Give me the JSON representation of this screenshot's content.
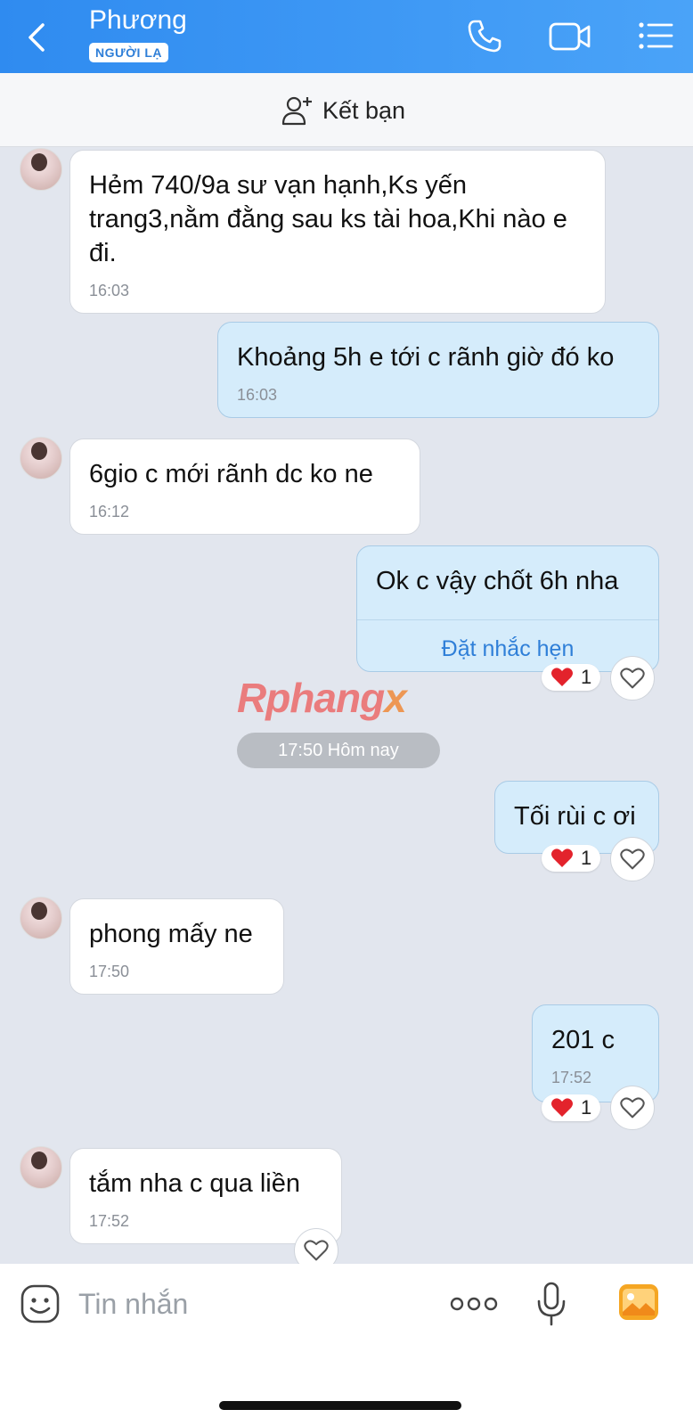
{
  "header": {
    "name": "Phương",
    "badge": "NGƯỜI LẠ",
    "bg_color": "#2f8bf0",
    "icons": [
      "back-chevron-icon",
      "phone-icon",
      "video-camera-icon",
      "menu-list-icon"
    ]
  },
  "add_friend": {
    "label": "Kết bạn",
    "icon": "add-user-icon"
  },
  "messages": [
    {
      "from": "them",
      "text": "Hẻm 740/9a sư vạn hạnh,Ks yến trang3,nằm đằng sau ks tài hoa,Khi nào e đi.",
      "time": "16:03"
    },
    {
      "from": "me",
      "text": "Khoảng 5h e tới c rãnh giờ đó ko",
      "time": "16:03"
    },
    {
      "from": "them",
      "text": "6gio c mới rãnh dc ko ne",
      "time": "16:12"
    },
    {
      "from": "me",
      "text": "Ok c vậy chốt 6h nha",
      "action": "Đặt nhắc hẹn",
      "reaction_count": "1"
    },
    {
      "from": "me",
      "text": "Tối rùi c ơi",
      "reaction_count": "1"
    },
    {
      "from": "them",
      "text": "phong mấy ne",
      "time": "17:50"
    },
    {
      "from": "me",
      "text": "201 c",
      "time": "17:52",
      "reaction_count": "1"
    },
    {
      "from": "them",
      "text": "tắm nha c qua liền",
      "time": "17:52"
    }
  ],
  "date_separator": "17:50 Hôm nay",
  "watermark": {
    "part1": "Rphang",
    "part2": "x"
  },
  "composer": {
    "placeholder": "Tin nhắn",
    "icons": [
      "emoji-icon",
      "more-icon",
      "microphone-icon",
      "gallery-icon"
    ]
  },
  "colors": {
    "accent": "#2f8bf0",
    "outgoing_bubble": "#d5ecfb",
    "incoming_bubble": "#ffffff",
    "background": "#e2e6ee",
    "reaction_heart": "#e3232c"
  }
}
